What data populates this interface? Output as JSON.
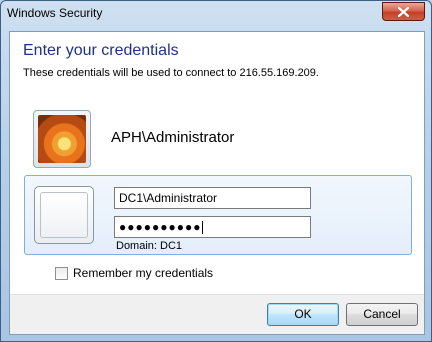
{
  "window": {
    "title": "Windows Security",
    "close_icon": "close-icon"
  },
  "dialog": {
    "heading": "Enter your credentials",
    "subtitle": "These credentials will be used to connect to 216.55.169.209."
  },
  "saved_credential": {
    "name": "APH\\Administrator",
    "avatar_icon": "user-photo-flower"
  },
  "active_credential": {
    "avatar_icon": "blank-user-tile",
    "username_value": "DC1\\Administrator",
    "password_mask": "●●●●●●●●●●",
    "domain_text": "Domain: DC1"
  },
  "remember": {
    "label": "Remember my credentials",
    "checked": false
  },
  "buttons": {
    "ok_label": "OK",
    "cancel_label": "Cancel"
  },
  "colors": {
    "heading": "#1e3287",
    "panel_border": "#84acdd",
    "close_button": "#c4402a"
  }
}
